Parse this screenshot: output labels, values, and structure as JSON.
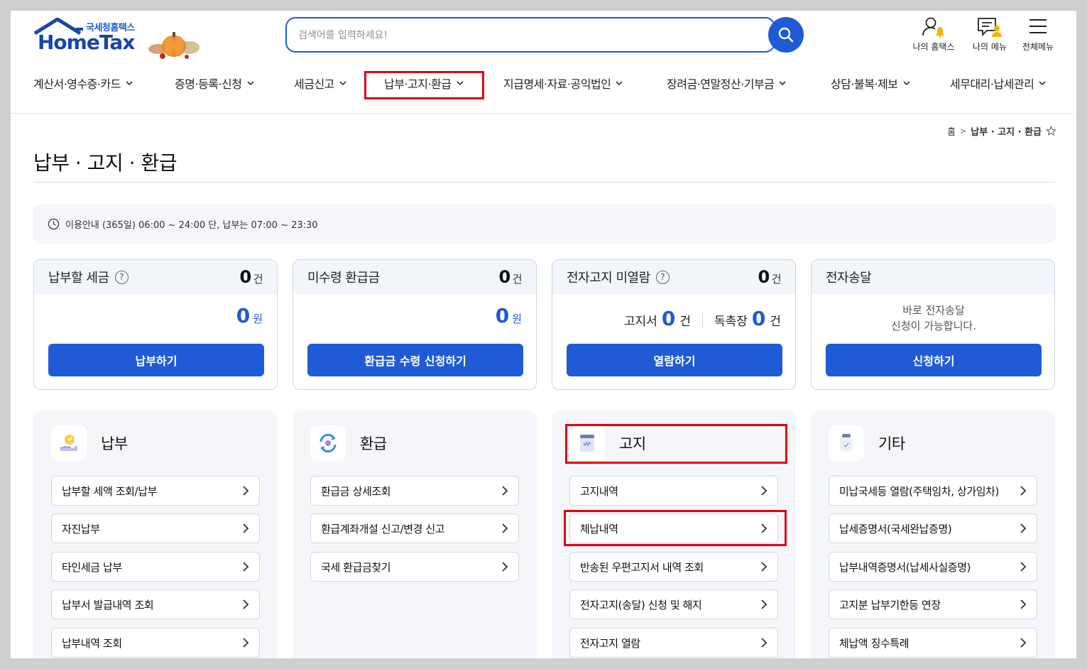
{
  "header": {
    "logo_kor": "국세청홈택스",
    "logo_text": "HomeTax",
    "search_placeholder": "검색어를 입력하세요!",
    "top_icons": [
      {
        "label": "나의 홈택스",
        "icon": "user-bell-icon"
      },
      {
        "label": "나의 메뉴",
        "icon": "my-menu-icon"
      },
      {
        "label": "전체메뉴",
        "icon": "hamburger-icon"
      }
    ]
  },
  "gnb": [
    "계산서·영수증·카드",
    "증명·등록·신청",
    "세금신고",
    "납부·고지·환급",
    "지급명세·자료·공익법인",
    "장려금·연말정산·기부금",
    "상담·불복·제보",
    "세무대리·납세관리"
  ],
  "breadcrumb": {
    "home": "홈",
    "current": "납부 · 고지 · 환급"
  },
  "page_title": "납부 · 고지 · 환급",
  "notice": "이용안내 (365일) 06:00 ~ 24:00 단, 납부는 07:00 ~ 23:30",
  "cards": [
    {
      "title": "납부할 세금",
      "help": "?",
      "count": "0",
      "count_unit": "건",
      "amount": "0",
      "amount_unit": "원",
      "button": "납부하기"
    },
    {
      "title": "미수령 환급금",
      "count": "0",
      "count_unit": "건",
      "amount": "0",
      "amount_unit": "원",
      "button": "환급금 수령 신청하기"
    },
    {
      "title": "전자고지 미열람",
      "help": "?",
      "count": "0",
      "count_unit": "건",
      "sub1_label": "고지서",
      "sub1_num": "0",
      "sub1_unit": "건",
      "sub2_label": "독촉장",
      "sub2_num": "0",
      "sub2_unit": "건",
      "button": "열람하기"
    },
    {
      "title": "전자송달",
      "desc1": "바로 전자송달",
      "desc2": "신청이 가능합니다.",
      "button": "신청하기"
    }
  ],
  "panels": [
    {
      "title": "납부",
      "links": [
        "납부할 세액 조회/납부",
        "자진납부",
        "타인세금 납부",
        "납부서 발급내역 조회",
        "납부내역 조회"
      ]
    },
    {
      "title": "환급",
      "links": [
        "환급금 상세조회",
        "환급계좌개설 신고/변경 신고",
        "국세 환급금찾기"
      ]
    },
    {
      "title": "고지",
      "links": [
        "고지내역",
        "체납내역",
        "반송된 우편고지서 내역 조회",
        "전자고지(송달) 신청 및 해지",
        "전자고지 열람"
      ]
    },
    {
      "title": "기타",
      "links": [
        "미납국세등 열람(주택임차, 상가임차)",
        "납세증명서(국세완납증명)",
        "납부내역증명서(납세사실증명)",
        "고지분 납부기한등 연장",
        "체납액 징수특례"
      ]
    }
  ],
  "colors": {
    "primary": "#1f5bd6",
    "highlight": "#e3000f",
    "panel_bg": "#f4f6fa"
  }
}
